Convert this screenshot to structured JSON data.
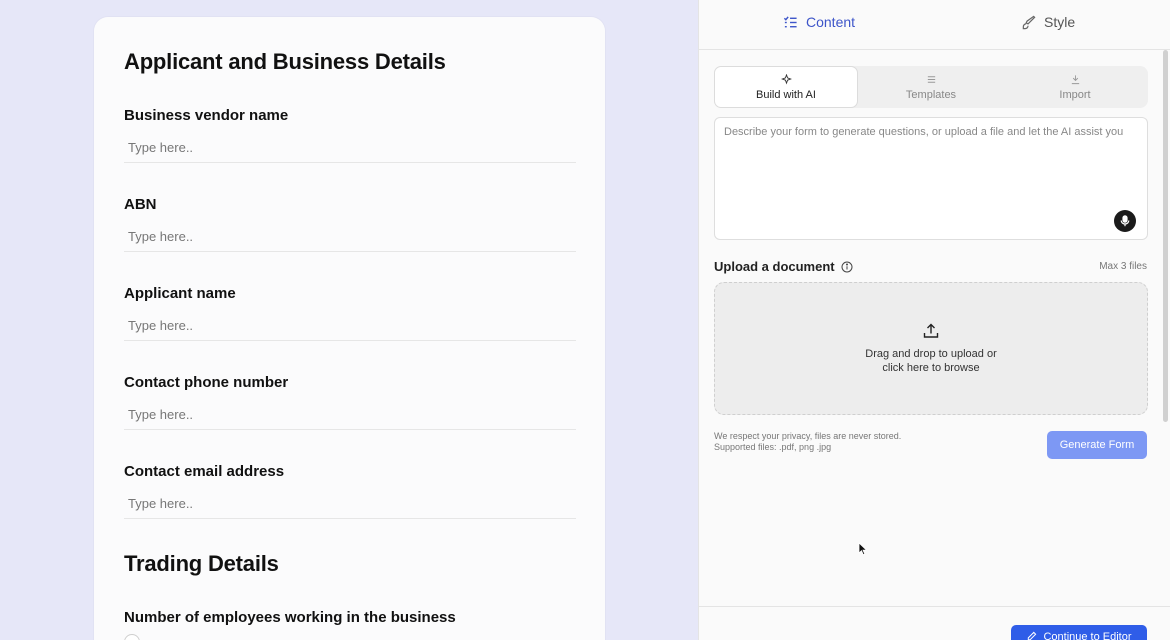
{
  "form": {
    "sections": [
      {
        "title": "Applicant and Business Details",
        "questions": [
          {
            "label": "Business vendor name",
            "placeholder": "Type here.."
          },
          {
            "label": "ABN",
            "placeholder": "Type here.."
          },
          {
            "label": "Applicant name",
            "placeholder": "Type here.."
          },
          {
            "label": "Contact phone number",
            "placeholder": "Type here.."
          },
          {
            "label": "Contact email address",
            "placeholder": "Type here.."
          }
        ]
      },
      {
        "title": "Trading Details",
        "questions": [
          {
            "label": "Number of employees working in the business"
          }
        ]
      }
    ]
  },
  "panel": {
    "tabs": [
      {
        "label": "Content",
        "icon": "list-check-icon",
        "active": true
      },
      {
        "label": "Style",
        "icon": "brush-icon",
        "active": false
      }
    ],
    "source_tabs": [
      {
        "label": "Build with AI",
        "icon": "sparkle-icon",
        "active": true
      },
      {
        "label": "Templates",
        "icon": "menu-icon",
        "active": false
      },
      {
        "label": "Import",
        "icon": "download-icon",
        "active": false
      }
    ],
    "prompt_placeholder": "Describe your form to generate questions, or upload a file and let the AI assist you",
    "upload": {
      "label": "Upload a document",
      "max_files": "Max 3 files",
      "drop_line1": "Drag and drop to upload or",
      "drop_line2": "click here to browse",
      "privacy_line1": "We respect your privacy, files are never stored.",
      "privacy_line2": "Supported files: .pdf, png .jpg"
    },
    "generate_label": "Generate Form",
    "continue_label": "Continue to Editor"
  },
  "colors": {
    "accent": "#3d55c9",
    "generate_button": "#7d98f4",
    "continue_button": "#2f5de8",
    "page_background": "#e6e7f8"
  }
}
